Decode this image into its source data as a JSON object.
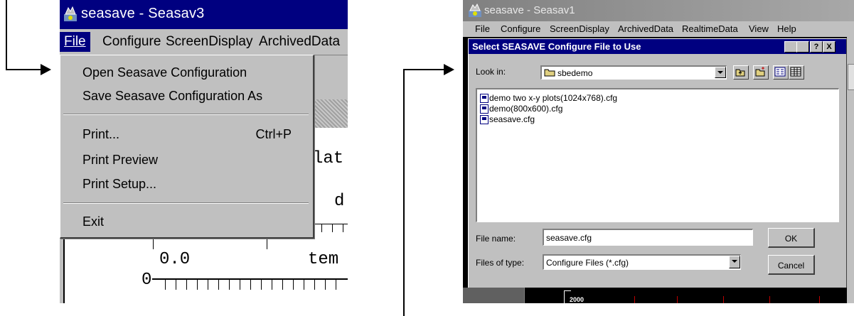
{
  "left": {
    "app_title": "seasave - Seasav3",
    "menus": [
      "File",
      "Configure",
      "ScreenDisplay",
      "ArchivedData"
    ],
    "dropdown": [
      {
        "label": "Open Seasave Configuration",
        "accel": ""
      },
      {
        "label": "Save Seasave Configuration As",
        "accel": ""
      },
      {
        "label": "Print...",
        "accel": "Ctrl+P"
      },
      {
        "label": "Print Preview",
        "accel": ""
      },
      {
        "label": "Print Setup...",
        "accel": ""
      },
      {
        "label": "Exit",
        "accel": ""
      }
    ],
    "bg_text": {
      "lat": "lat:",
      "d": "d",
      "value": "0.0",
      "tem": "tem",
      "zero": "0"
    }
  },
  "right": {
    "app_title": "seasave - Seasav1",
    "menus": [
      "File",
      "Configure",
      "ScreenDisplay",
      "ArchivedData",
      "RealtimeData",
      "View",
      "Help"
    ],
    "dialog": {
      "title": "Select SEASAVE Configure File to Use",
      "look_in_label": "Look in:",
      "look_in_value": "sbedemo",
      "files": [
        "demo two x-y plots(1024x768).cfg",
        "demo(800x600).cfg",
        "seasave.cfg"
      ],
      "filename_label": "File name:",
      "filename_value": "seasave.cfg",
      "filetype_label": "Files of type:",
      "filetype_value": "Configure Files (*.cfg)",
      "ok_label": "OK",
      "cancel_label": "Cancel",
      "caption_buttons": [
        "?",
        "X"
      ]
    },
    "bg_text": {
      "axis_label": "2000"
    }
  },
  "colors": {
    "title_active": "#000080",
    "title_inactive": "#808080",
    "face": "#c0c0c0"
  }
}
